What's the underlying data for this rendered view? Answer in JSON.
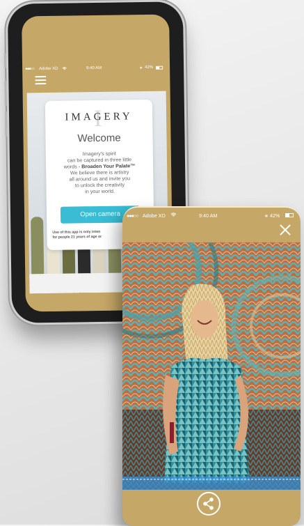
{
  "back_phone": {
    "status_bar": {
      "signal_dots": "●●●○○",
      "carrier": "Adobe XD",
      "time": "9:40 AM",
      "battery_pct": "42%"
    },
    "card": {
      "logo_text": "IMAGERY",
      "logo_bg_letter": "I",
      "title": "Welcome",
      "line1": "Imagery's spirit",
      "line2": "can be captured in three little",
      "line3_prefix": "words - ",
      "line3_bold": "Broaden Your Palate™",
      "line4": "We believe there is artistry",
      "line5": "all around us and invite you",
      "line6": "to unlock the creativity",
      "line7": "in your world.",
      "button_label": "Open camera",
      "disclaimer_1": "Use of this app is only inten",
      "disclaimer_2": "for people 21 years of age or"
    }
  },
  "front_phone": {
    "status_bar": {
      "signal_dots": "●●●○○",
      "carrier": "Adobe XD",
      "time": "9:40 AM",
      "battery_pct": "42%"
    },
    "close_icon": "close-icon",
    "share_icon": "share-icon"
  },
  "colors": {
    "gold": "#c5a767",
    "button_blue": "#39bcd4"
  }
}
